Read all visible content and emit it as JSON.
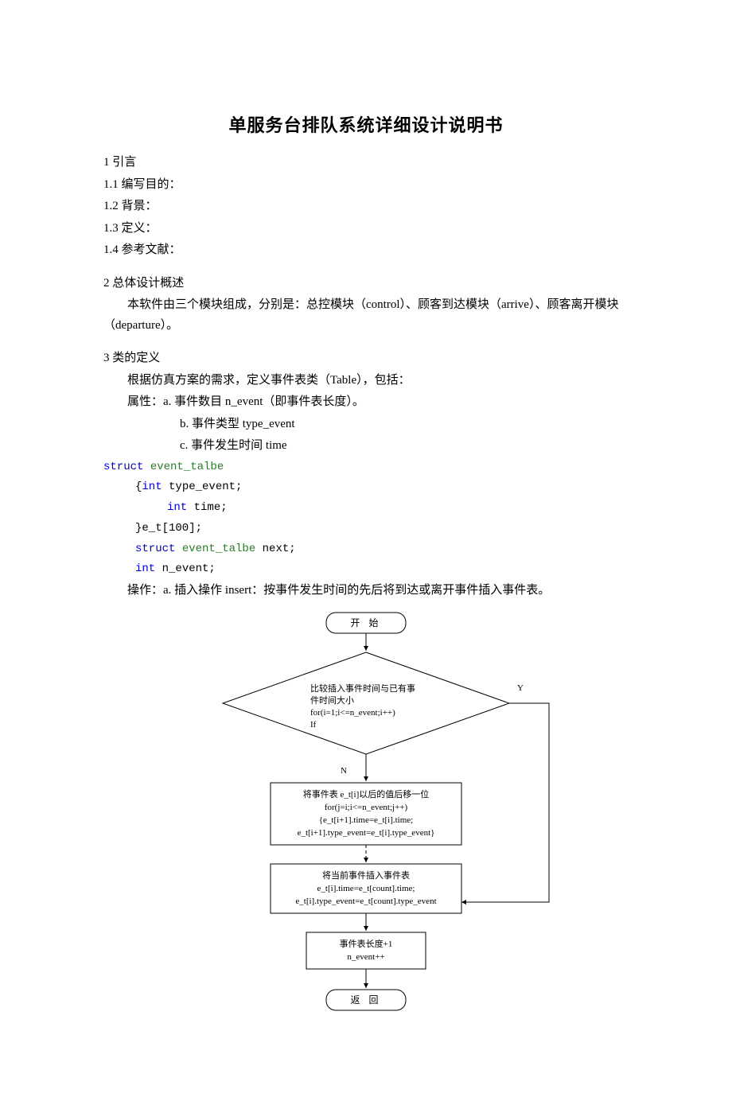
{
  "title": "单服务台排队系统详细设计说明书",
  "sec1": {
    "h": "1 引言",
    "s1": "1.1 编写目的：",
    "s2": "1.2 背景：",
    "s3": "1.3 定义：",
    "s4": "1.4 参考文献："
  },
  "sec2": {
    "h": "2 总体设计概述",
    "p": "本软件由三个模块组成，分别是：总控模块（control）、顾客到达模块（arrive）、顾客离开模块（departure）。"
  },
  "sec3": {
    "h": "3 类的定义",
    "p1": "根据仿真方案的需求，定义事件表类（Table），包括：",
    "attr": "属性：a. 事件数目 n_event（即事件表长度）。",
    "attr_b": "b. 事件类型 type_event",
    "attr_c": "c. 事件发生时间 time",
    "code": {
      "l1a": "struct",
      "l1b": " event_talbe",
      "l2a": "{",
      "l2b": "int",
      "l2c": " type_event;",
      "l3a": "int",
      "l3b": " time;",
      "l4": "}e_t[100];",
      "l5a": "struct",
      "l5b": " event_talbe",
      "l5c": " next;",
      "l6a": "int",
      "l6b": " n_event;"
    },
    "op": "操作：a. 插入操作 insert：按事件发生时间的先后将到达或离开事件插入事件表。"
  },
  "flow": {
    "start": "开  始",
    "decision_l1": "比较插入事件时间与已有事",
    "decision_l2": "件时间大小",
    "decision_l3": "for(i=1;i<=n_event;i++)",
    "decision_l4": "If",
    "yes": "Y",
    "no": "N",
    "box1_l1": "将事件表 e_t[i]以后的值后移一位",
    "box1_l2": "for(j=i;i<=n_event;j++)",
    "box1_l3": "{e_t[i+1].time=e_t[i].time;",
    "box1_l4": "e_t[i+1].type_event=e_t[i].type_event}",
    "box2_l1": "将当前事件插入事件表",
    "box2_l2": "e_t[i].time=e_t[count].time;",
    "box2_l3": "e_t[i].type_event=e_t[count].type_event",
    "box3_l1": "事件表长度+1",
    "box3_l2": "n_event++",
    "end": "返  回"
  }
}
